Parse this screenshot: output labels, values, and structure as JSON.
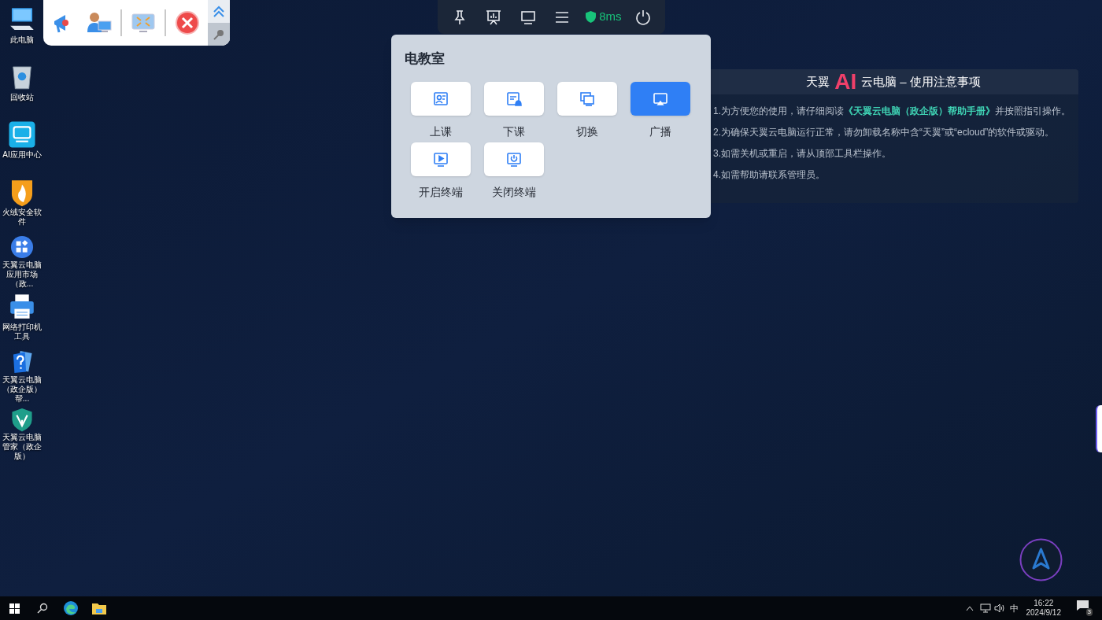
{
  "desktop_icons": [
    {
      "kind": "computer",
      "label": "此电脑"
    },
    {
      "kind": "recycle",
      "label": "回收站"
    },
    {
      "kind": "ai",
      "label": "AI应用中心"
    },
    {
      "kind": "flame",
      "label": "火绒安全软件"
    },
    {
      "kind": "store",
      "label": "天翼云电脑应用市场（政..."
    },
    {
      "kind": "printer",
      "label": "网络打印机工具"
    },
    {
      "kind": "help",
      "label": "天翼云电脑（政企版）帮..."
    },
    {
      "kind": "shield",
      "label": "天翼云电脑管家（政企版）"
    }
  ],
  "floating_toolbar": {
    "items": [
      {
        "kind": "megaphone"
      },
      {
        "kind": "teacher"
      },
      {
        "kind": "shrink"
      },
      {
        "kind": "close"
      }
    ]
  },
  "top_toolbar": {
    "latency": "8ms"
  },
  "classroom_panel": {
    "title": "电教室",
    "buttons": [
      {
        "kind": "start",
        "label": "上课",
        "selected": false
      },
      {
        "kind": "end",
        "label": "下课",
        "selected": false
      },
      {
        "kind": "switch",
        "label": "切换",
        "selected": false
      },
      {
        "kind": "broadcast",
        "label": "广播",
        "selected": true
      },
      {
        "kind": "power_on",
        "label": "开启终端",
        "selected": false
      },
      {
        "kind": "power_off",
        "label": "关闭终端",
        "selected": false
      }
    ]
  },
  "notice": {
    "title_prefix": "天翼",
    "title_logo": "AI",
    "title": "云电脑 – 使用注意事项",
    "lines": [
      "1.为方便您的使用，请仔细阅读**《天翼云电脑（政企版）帮助手册》**并按照指引操作。",
      "2.为确保天翼云电脑运行正常，请勿卸载名称中含“天翼”或“ecloud”的软件或驱动。",
      "3.如需关机或重启，请从顶部工具栏操作。",
      "4.如需帮助请联系管理员。"
    ]
  },
  "taskbar": {
    "ime": "中",
    "time": "16:22",
    "date": "2024/9/12",
    "notification_count": "3"
  }
}
